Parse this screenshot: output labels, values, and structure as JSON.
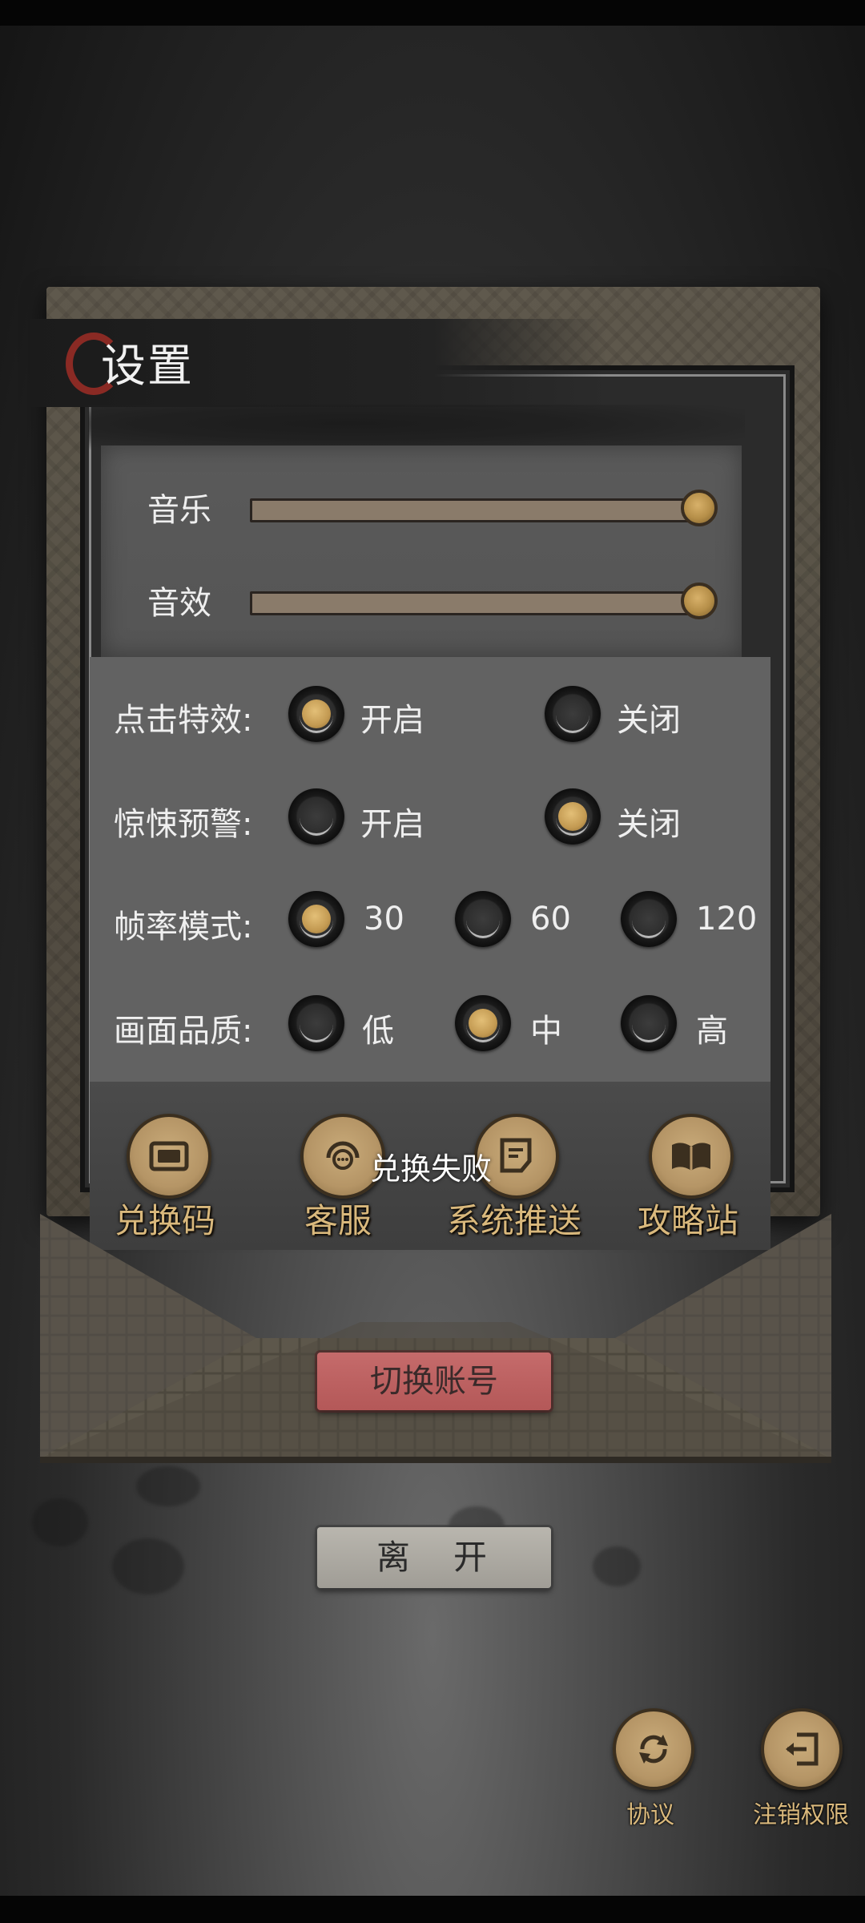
{
  "title": "设置",
  "audio": {
    "music_label": "音乐",
    "music_level": 1.0,
    "sfx_label": "音效",
    "sfx_level": 1.0
  },
  "options": {
    "click_effect": {
      "label": "点击特效:",
      "choices": [
        "开启",
        "关闭"
      ],
      "selected": "开启"
    },
    "horror_warning": {
      "label": "惊悚预警:",
      "choices": [
        "开启",
        "关闭"
      ],
      "selected": "关闭"
    },
    "frame_rate": {
      "label": "帧率模式:",
      "choices": [
        "30",
        "60",
        "120"
      ],
      "selected": "30"
    },
    "quality": {
      "label": "画面品质:",
      "choices": [
        "低",
        "中",
        "高"
      ],
      "selected": "中"
    }
  },
  "buttons": {
    "redeem": "兑换码",
    "service": "客服",
    "push": "系统推送",
    "guide": "攻略站"
  },
  "toast": "兑换失败",
  "switch_account": "切换账号",
  "leave": "离　开",
  "footer": {
    "agreement": "协议",
    "cancel_permission": "注销权限"
  },
  "colors": {
    "accent_gold": "#c39a52",
    "switch_button": "#c56b6b",
    "icon_label": "#d9b87c"
  }
}
